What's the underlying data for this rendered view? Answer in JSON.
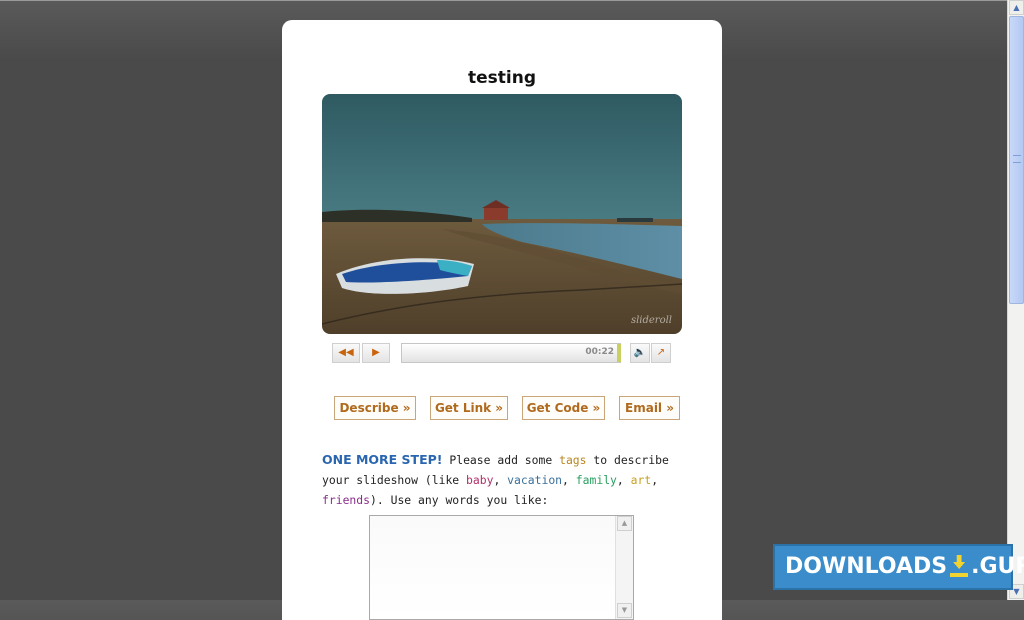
{
  "slideshow": {
    "title": "testing",
    "watermark": "slideroll"
  },
  "player": {
    "rewind_icon": "rewind-icon",
    "play_icon": "play-icon",
    "time": "00:22",
    "progress": 1.0,
    "volume_icon": "volume-icon",
    "popout_icon": "popout-icon"
  },
  "actions": {
    "describe": "Describe »",
    "get_link": "Get Link »",
    "get_code": "Get Code »",
    "email": "Email »"
  },
  "instructions": {
    "lead": "ONE MORE STEP!",
    "part1": " Please add some ",
    "tags_word": "tags",
    "part2": " to describe your slideshow (like ",
    "examples": [
      "baby",
      "vacation",
      "family",
      "art",
      "friends"
    ],
    "part3": "). Use any words you like:"
  },
  "tag_input": {
    "value": ""
  },
  "logo": {
    "left": "DOWNLOADS",
    "right": ".GURU"
  },
  "colors": {
    "accent_orange": "#b06a1e",
    "lead_blue": "#2a66b0",
    "logo_blue": "#3a8dca"
  }
}
